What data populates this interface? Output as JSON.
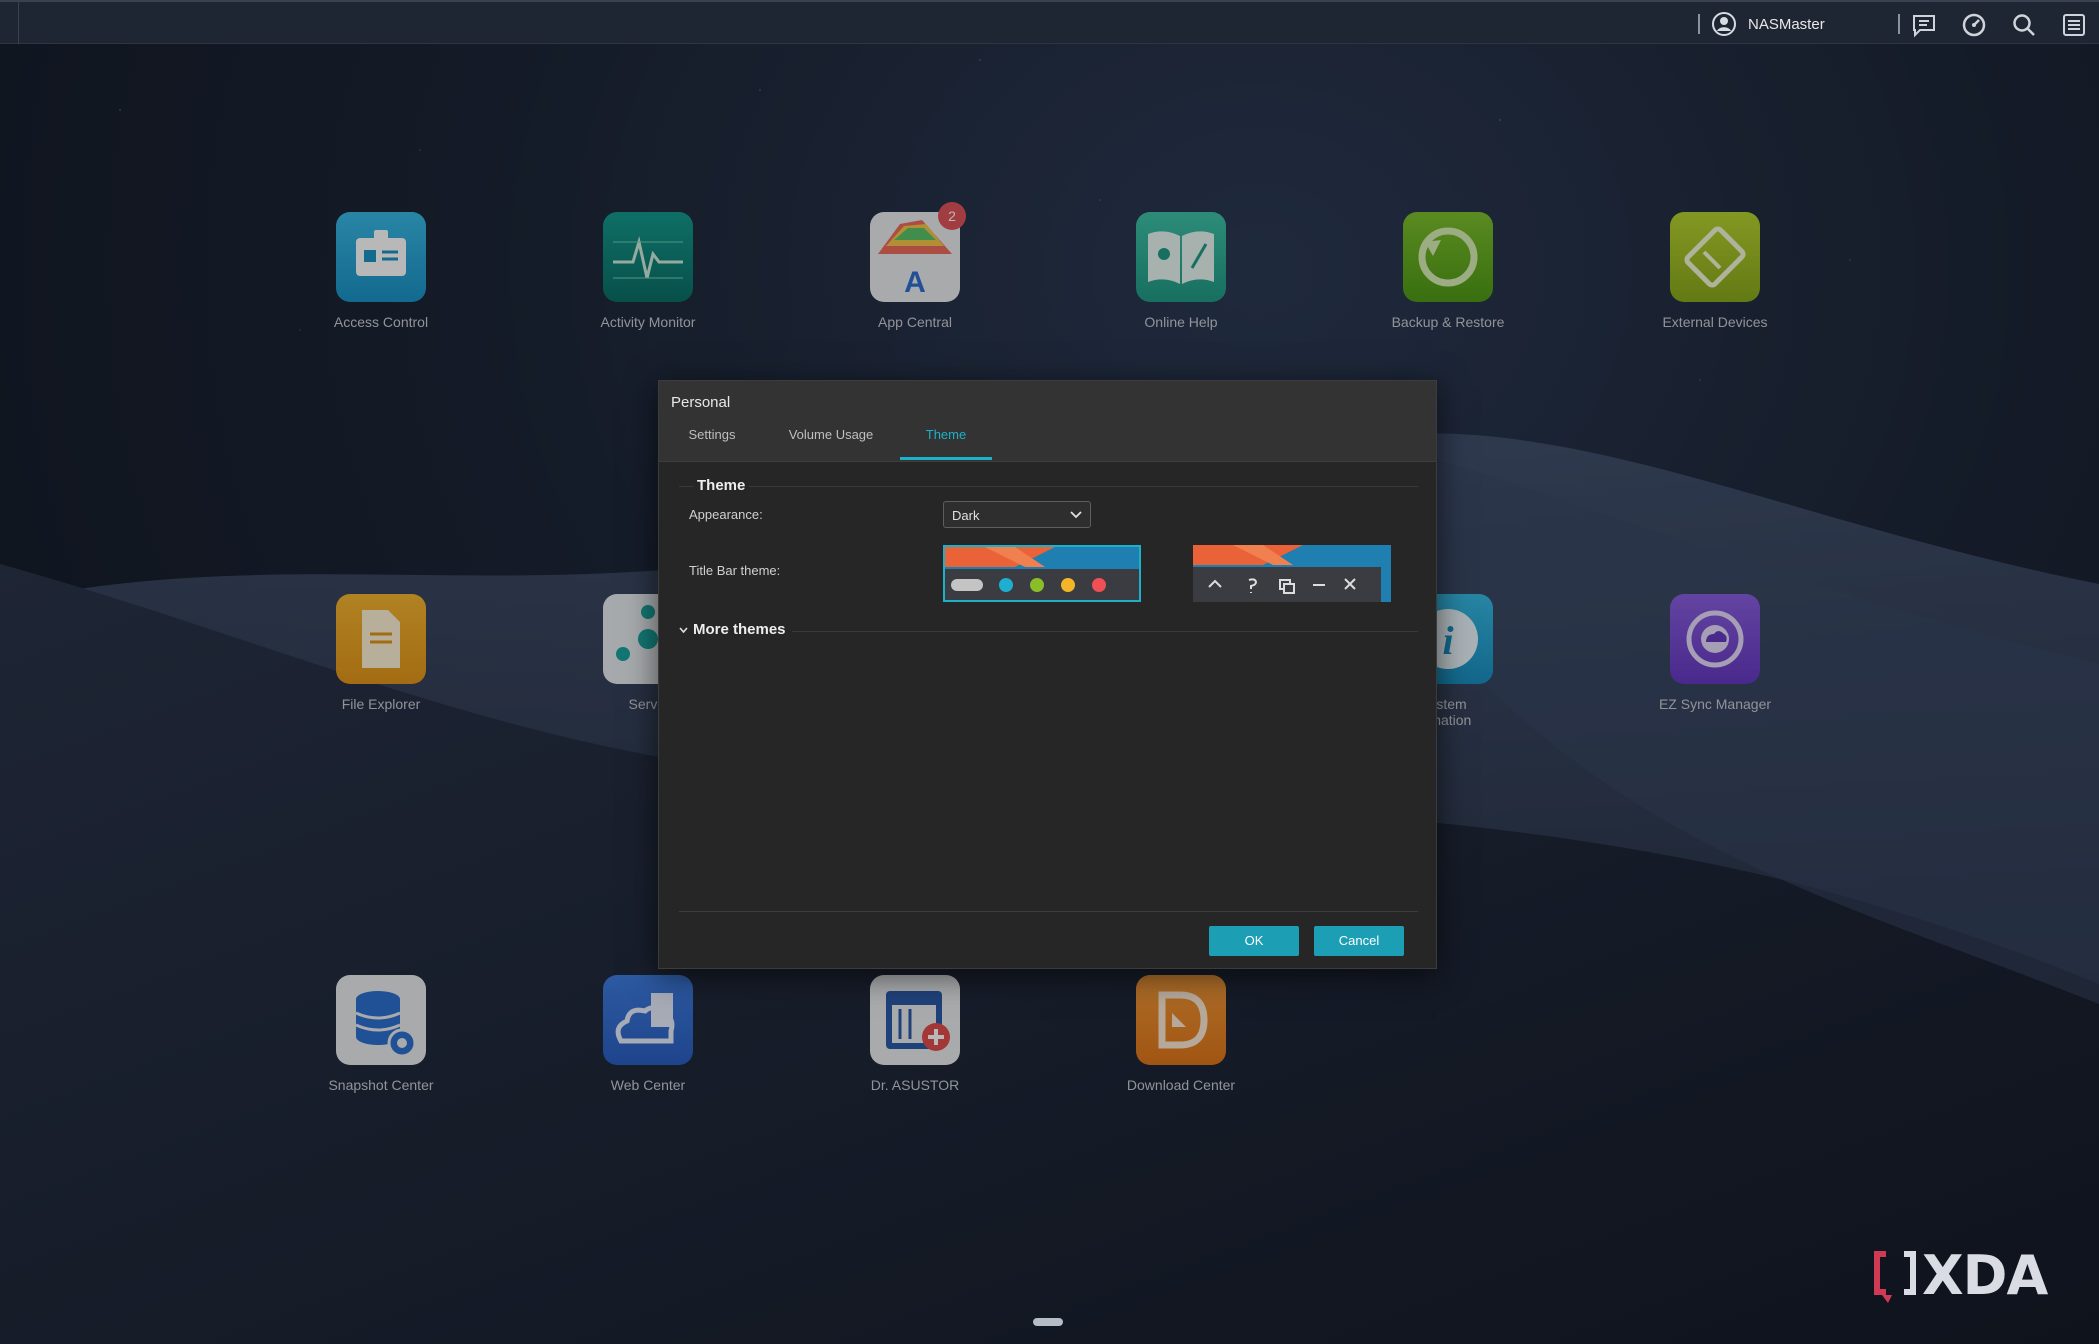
{
  "topbar": {
    "username": "NASMaster"
  },
  "desktop": {
    "row1": [
      {
        "label": "Access Control",
        "icon": "access-control-icon"
      },
      {
        "label": "Activity Monitor",
        "icon": "activity-monitor-icon"
      },
      {
        "label": "App Central",
        "icon": "app-central-icon",
        "badge": "2"
      },
      {
        "label": "Online Help",
        "icon": "online-help-icon"
      },
      {
        "label": "Backup & Restore",
        "icon": "backup-restore-icon"
      },
      {
        "label": "External Devices",
        "icon": "external-devices-icon"
      }
    ],
    "row2": [
      {
        "label": "File Explorer",
        "icon": "file-explorer-icon"
      },
      {
        "label": "Servic",
        "icon": "services-icon"
      },
      {
        "label": "ystem\nrmation",
        "icon": "system-information-icon"
      },
      {
        "label": "EZ Sync Manager",
        "icon": "ez-sync-manager-icon"
      }
    ],
    "row3": [
      {
        "label": "Snapshot Center",
        "icon": "snapshot-center-icon"
      },
      {
        "label": "Web Center",
        "icon": "web-center-icon"
      },
      {
        "label": "Dr. ASUSTOR",
        "icon": "dr-asustor-icon"
      },
      {
        "label": "Download Center",
        "icon": "download-center-icon"
      }
    ]
  },
  "dialog": {
    "title": "Personal",
    "tabs": [
      {
        "label": "Settings",
        "active": false
      },
      {
        "label": "Volume Usage",
        "active": false
      },
      {
        "label": "Theme",
        "active": true
      }
    ],
    "section_title": "Theme",
    "appearance_label": "Appearance:",
    "appearance_value": "Dark",
    "title_bar_label": "Title Bar theme:",
    "more_themes": "More themes",
    "ok": "OK",
    "cancel": "Cancel"
  },
  "colors": {
    "accent": "#1cb1c8",
    "button": "#1c9fb5"
  },
  "watermark": "XDA"
}
